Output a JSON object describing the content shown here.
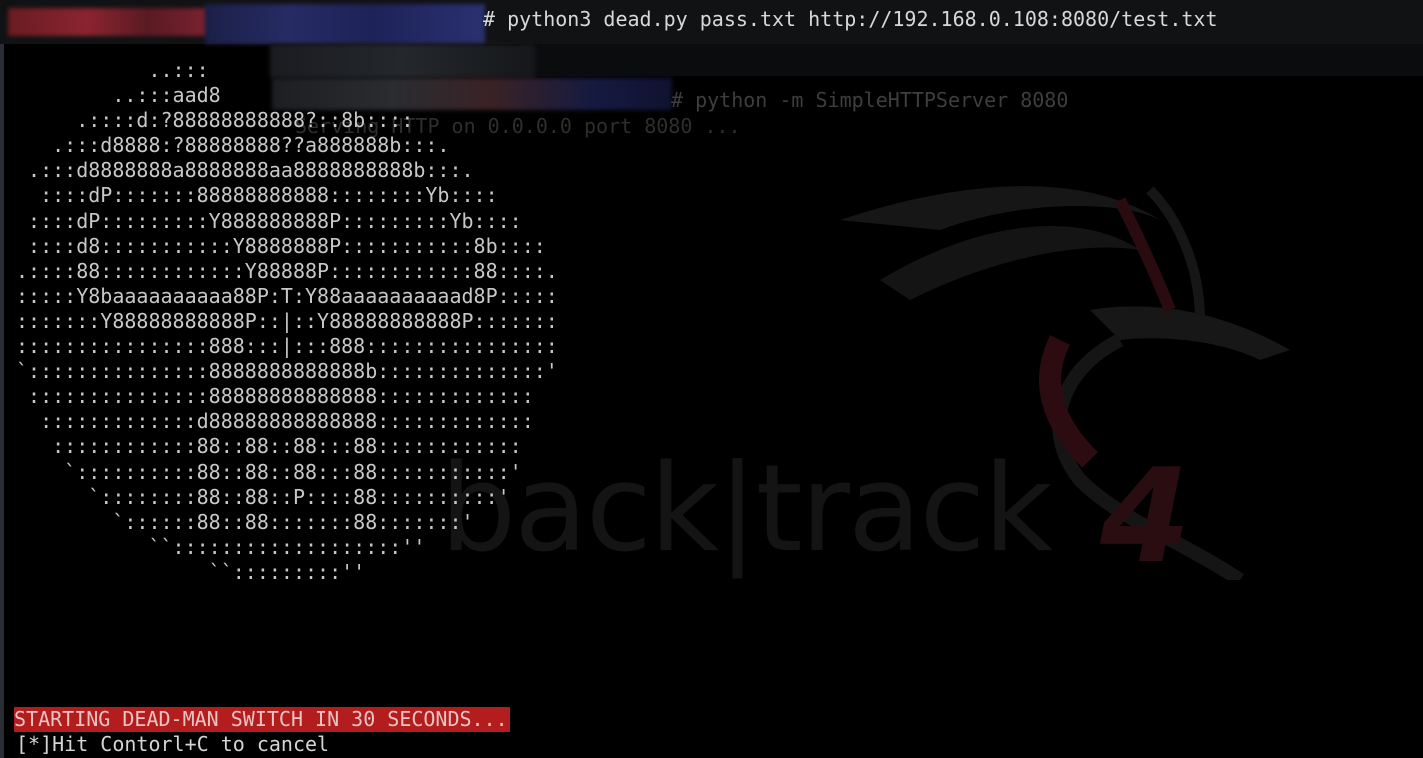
{
  "terminal": {
    "command": "# python3 dead.py pass.txt http://192.168.0.108:8080/test.txt",
    "background_command": "# python -m SimpleHTTPServer 8080",
    "background_output": "Serving HTTP on 0.0.0.0 port 8080 ..."
  },
  "ascii_art": [
    "           ..:::",
    "        ..:::aad8",
    "     .::::d:?88888888888?::8b::::",
    "   .:::d8888:?88888888??a888888b:::.",
    " .:::d8888888a8888888aa8888888888b:::.",
    "  ::::dP:::::::88888888888::::::::Yb::::",
    " ::::dP:::::::::Y888888888P:::::::::Yb::::",
    " ::::d8:::::::::::Y8888888P:::::::::::8b::::",
    ".::::88::::::::::::Y88888P::::::::::::88::::.",
    ":::::Y8baaaaaaaaaa88P:T:Y88aaaaaaaaaad8P:::::",
    ":::::::Y88888888888P::|::Y88888888888P:::::::",
    "::::::::::::::::888:::|:::888::::::::::::::::",
    "`:::::::::::::::8888888888888b::::::::::::::'",
    " :::::::::::::::88888888888888:::::::::::::",
    "  :::::::::::::d88888888888888:::::::::::::",
    "   ::::::::::::88::88::88:::88::::::::::::",
    "    `::::::::::88::88::88:::88:::::::::::'",
    "      `::::::::88::88::P::::88::::::::::'",
    "        `::::::88::88:::::::88:::::::'",
    "           ``:::::::::::::::::::''",
    "                ``:::::::::''"
  ],
  "warning": "STARTING DEAD-MAN SWITCH IN 30 SECONDS...",
  "hint": "[*]Hit Contorl+C to cancel",
  "wallpaper": {
    "text": "back|track",
    "number": "4"
  },
  "colors": {
    "warning_bg": "#b31d1d",
    "text": "#d8d8d8"
  }
}
